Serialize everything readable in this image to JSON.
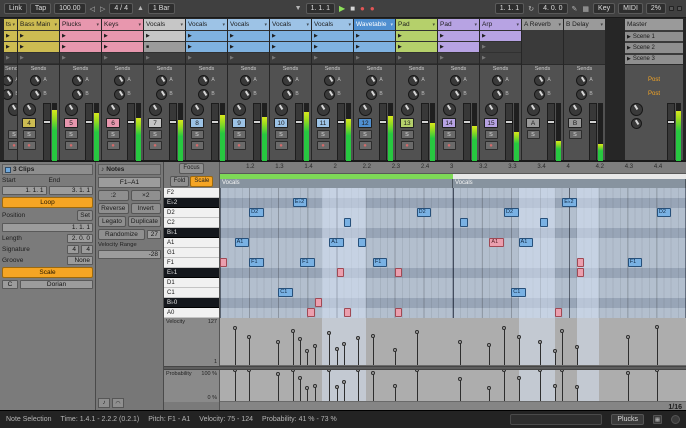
{
  "icons": {
    "follow": "▼",
    "play": "▶",
    "stop": "■",
    "record": "●",
    "session_record": "●",
    "metronome": "▲",
    "loop": "↻",
    "draw": "✎",
    "keyboard": "▦",
    "note": "♪",
    "envelope": "◠",
    "scene_play": "▶",
    "clip_play": "▶",
    "clip_stop": "■",
    "chevron": "▾",
    "lock": "◆"
  },
  "transport": {
    "link": "Link",
    "tap": "Tap",
    "tempo": "100.00",
    "nudge_down": "◁",
    "nudge_up": "▷",
    "sig": "4 / 4",
    "quantize": "1 Bar",
    "position": "1. 1. 1",
    "loop_start": "1. 1. 1",
    "loop_length": "4. 0. 0",
    "key": "Key",
    "midi": "MIDI",
    "cpu": "2%"
  },
  "session": {
    "sends_label": "Sends",
    "send_letters": [
      "A",
      "B"
    ],
    "solo_label": "S",
    "tracks": [
      {
        "name": "ts",
        "color": "#cdbc52",
        "partial": true,
        "num": "",
        "level": 0.8,
        "clips": [
          {
            "t": "clip",
            "c": "#cdbc52"
          },
          {
            "t": "clip",
            "c": "#cdbc52"
          },
          {
            "t": "empty"
          }
        ]
      },
      {
        "name": "Bass Main",
        "color": "#cdbc52",
        "num": "4",
        "level": 0.88,
        "clips": [
          {
            "t": "clip",
            "c": "#cdbc52"
          },
          {
            "t": "clip",
            "c": "#cdbc52"
          },
          {
            "t": "empty"
          }
        ]
      },
      {
        "name": "Plucks",
        "color": "#e897ae",
        "num": "5",
        "level": 0.82,
        "clips": [
          {
            "t": "clip",
            "c": "#e897ae"
          },
          {
            "t": "clip",
            "c": "#e897ae"
          },
          {
            "t": "empty"
          }
        ]
      },
      {
        "name": "Keys",
        "color": "#e897ae",
        "num": "6",
        "level": 0.75,
        "clips": [
          {
            "t": "clip",
            "c": "#e897ae"
          },
          {
            "t": "clip",
            "c": "#e897ae"
          },
          {
            "t": "empty"
          }
        ]
      },
      {
        "name": "Vocals",
        "color": "#c6c6c6",
        "num": "7",
        "level": 0.7,
        "clips": [
          {
            "t": "clip",
            "c": "#c6c6c6"
          },
          {
            "t": "stop"
          },
          {
            "t": "empty"
          }
        ]
      },
      {
        "name": "Vocals",
        "color": "#9dc3e6",
        "num": "8",
        "level": 0.8,
        "clips": [
          {
            "t": "clip",
            "c": "#7fb2e0"
          },
          {
            "t": "clip",
            "c": "#7fb2e0"
          },
          {
            "t": "empty"
          }
        ]
      },
      {
        "name": "Vocals",
        "color": "#9dc3e6",
        "num": "9",
        "level": 0.76,
        "clips": [
          {
            "t": "clip",
            "c": "#7fb2e0"
          },
          {
            "t": "clip",
            "c": "#7fb2e0"
          },
          {
            "t": "empty"
          }
        ]
      },
      {
        "name": "Vocals",
        "color": "#9dc3e6",
        "num": "10",
        "level": 0.84,
        "clips": [
          {
            "t": "clip",
            "c": "#7fb2e0"
          },
          {
            "t": "clip",
            "c": "#7fb2e0"
          },
          {
            "t": "empty"
          }
        ]
      },
      {
        "name": "Vocals",
        "color": "#9dc3e6",
        "num": "11",
        "level": 0.72,
        "clips": [
          {
            "t": "clip",
            "c": "#7fb2e0"
          },
          {
            "t": "clip",
            "c": "#7fb2e0"
          },
          {
            "t": "empty"
          }
        ]
      },
      {
        "name": "Wavetable",
        "color": "#4f8fd0",
        "selected": true,
        "num": "12",
        "level": 0.78,
        "clips": [
          {
            "t": "clip",
            "c": "#7fb2e0"
          },
          {
            "t": "clip",
            "c": "#7fb2e0"
          },
          {
            "t": "empty"
          }
        ]
      },
      {
        "name": "Pad",
        "color": "#b5d06b",
        "num": "13",
        "level": 0.66,
        "clips": [
          {
            "t": "clip",
            "c": "#b5d06b"
          },
          {
            "t": "clip",
            "c": "#b5d06b"
          },
          {
            "t": "empty"
          }
        ]
      },
      {
        "name": "Pad",
        "color": "#b7a3e3",
        "num": "14",
        "level": 0.6,
        "clips": [
          {
            "t": "clip",
            "c": "#b7a3e3"
          },
          {
            "t": "clip",
            "c": "#b7a3e3"
          },
          {
            "t": "empty"
          }
        ]
      },
      {
        "name": "Arp",
        "color": "#b7a3e3",
        "num": "15",
        "level": 0.5,
        "clips": [
          {
            "t": "clip",
            "c": "#b7a3e3"
          },
          {
            "t": "empty"
          },
          {
            "t": "empty"
          }
        ]
      },
      {
        "name": "A Reverb",
        "color": "#9a9a9a",
        "num": "A",
        "type": "return",
        "noarm": true,
        "level": 0.35,
        "clips": []
      },
      {
        "name": "B Delay",
        "color": "#9a9a9a",
        "num": "B",
        "type": "return",
        "noarm": true,
        "level": 0.3,
        "clips": []
      }
    ],
    "scenes": [
      "Scene 1",
      "Scene 2",
      "Scene 3"
    ],
    "master": {
      "name": "Master",
      "post_labels": [
        "Post",
        "Post"
      ],
      "level": 0.86
    }
  },
  "clip_panel": {
    "title": "3 Clips",
    "start_label": "Start",
    "end_label": "End",
    "start_value": "1. 1. 1",
    "end_value": "3. 1. 1",
    "loop_label": "Loop",
    "position_label": "Position",
    "set_label": "Set",
    "position_value": "1. 1. 1",
    "length_label": "Length",
    "length_value": "2. 0. 0",
    "signature_label": "Signature",
    "sig_num": "4",
    "sig_den": "4",
    "groove_label": "Groove",
    "groove_value": "None",
    "scale_label": "Scale",
    "root": "C",
    "scale_name": "Dorian"
  },
  "notes_panel": {
    "title": "Notes",
    "range": "F1–A1",
    "half": ":2",
    "double": "×2",
    "reverse": "Reverse",
    "invert": "Invert",
    "legato": "Legato",
    "duplicate": "Duplicate",
    "randomize_label": "Randomize",
    "randomize_value": "27",
    "velocity_range_label": "Velocity Range",
    "velocity_range_value": "-28"
  },
  "editor": {
    "focus": "Focus",
    "fold": "Fold",
    "scale": "Scale",
    "grid_label": "1/16",
    "ruler": [
      "1.2",
      "1.3",
      "1.4",
      "2",
      "2.2",
      "2.3",
      "2.4",
      "3",
      "3.2",
      "3.3",
      "3.4",
      "4",
      "4.2",
      "4.3",
      "4.4"
    ],
    "clip_regions": [
      {
        "label": "Vocals",
        "s": 0,
        "d": 32,
        "bar": "#7ed957"
      },
      {
        "label": "Vocals",
        "s": 32,
        "d": 32,
        "bar": "#e8e8e8"
      }
    ],
    "pitches": [
      {
        "name": "F2",
        "black": false
      },
      {
        "name": "E♭2",
        "black": true
      },
      {
        "name": "D2",
        "black": false
      },
      {
        "name": "C2",
        "black": false
      },
      {
        "name": "B♭1",
        "black": true
      },
      {
        "name": "A1",
        "black": false
      },
      {
        "name": "G1",
        "black": false
      },
      {
        "name": "F1",
        "black": false
      },
      {
        "name": "E♭1",
        "black": true
      },
      {
        "name": "D1",
        "black": false
      },
      {
        "name": "C1",
        "black": false
      },
      {
        "name": "B♭0",
        "black": true
      },
      {
        "name": "A0",
        "black": false
      }
    ],
    "selection_bands": [
      {
        "s": 14,
        "d": 6
      },
      {
        "s": 41,
        "d": 5
      },
      {
        "s": 49,
        "d": 3
      }
    ],
    "notes": [
      {
        "row": 5,
        "s": 2,
        "d": 2,
        "label": "A1"
      },
      {
        "row": 2,
        "s": 4,
        "d": 2,
        "label": "D2"
      },
      {
        "row": 7,
        "s": 0,
        "d": 1,
        "muted": true
      },
      {
        "row": 7,
        "s": 4,
        "d": 2,
        "label": "F1"
      },
      {
        "row": 10,
        "s": 8,
        "d": 2,
        "label": "C1"
      },
      {
        "row": 1,
        "s": 10,
        "d": 2,
        "label": "E♭2"
      },
      {
        "row": 7,
        "s": 11,
        "d": 2,
        "label": "F1"
      },
      {
        "row": 12,
        "s": 12,
        "d": 1,
        "muted": true
      },
      {
        "row": 11,
        "s": 13,
        "d": 1,
        "muted": true
      },
      {
        "row": 5,
        "s": 15,
        "d": 2,
        "label": "A1"
      },
      {
        "row": 8,
        "s": 16,
        "d": 1,
        "muted": true
      },
      {
        "row": 3,
        "s": 17,
        "d": 1
      },
      {
        "row": 12,
        "s": 17,
        "d": 1,
        "muted": true
      },
      {
        "row": 5,
        "s": 19,
        "d": 1
      },
      {
        "row": 7,
        "s": 21,
        "d": 2,
        "label": "F1"
      },
      {
        "row": 8,
        "s": 24,
        "d": 1,
        "muted": true
      },
      {
        "row": 12,
        "s": 24,
        "d": 1,
        "muted": true
      },
      {
        "row": 2,
        "s": 27,
        "d": 2,
        "label": "D2"
      },
      {
        "row": 3,
        "s": 33,
        "d": 1
      },
      {
        "row": 5,
        "s": 37,
        "d": 2,
        "label": "A1",
        "muted": true
      },
      {
        "row": 2,
        "s": 39,
        "d": 2,
        "label": "D2"
      },
      {
        "row": 10,
        "s": 40,
        "d": 2,
        "label": "C1"
      },
      {
        "row": 5,
        "s": 41,
        "d": 2,
        "label": "A1"
      },
      {
        "row": 3,
        "s": 44,
        "d": 1
      },
      {
        "row": 12,
        "s": 46,
        "d": 1,
        "muted": true
      },
      {
        "row": 1,
        "s": 47,
        "d": 2,
        "label": "E♭2"
      },
      {
        "row": 7,
        "s": 49,
        "d": 1,
        "muted": true
      },
      {
        "row": 8,
        "s": 49,
        "d": 1,
        "muted": true
      },
      {
        "row": 7,
        "s": 56,
        "d": 2,
        "label": "F1"
      },
      {
        "row": 2,
        "s": 60,
        "d": 2,
        "label": "D2"
      }
    ],
    "velocity": {
      "label": "Velocity",
      "top": "127",
      "bottom": "1",
      "markers": [
        {
          "u": 2,
          "v": 0.78
        },
        {
          "u": 4,
          "v": 0.6
        },
        {
          "u": 8,
          "v": 0.5
        },
        {
          "u": 10,
          "v": 0.72
        },
        {
          "u": 11,
          "v": 0.55
        },
        {
          "u": 12,
          "v": 0.3
        },
        {
          "u": 13,
          "v": 0.4
        },
        {
          "u": 15,
          "v": 0.68
        },
        {
          "u": 16,
          "v": 0.35
        },
        {
          "u": 17,
          "v": 0.45
        },
        {
          "u": 19,
          "v": 0.58
        },
        {
          "u": 21,
          "v": 0.62
        },
        {
          "u": 24,
          "v": 0.33
        },
        {
          "u": 27,
          "v": 0.7
        },
        {
          "u": 33,
          "v": 0.5
        },
        {
          "u": 37,
          "v": 0.42
        },
        {
          "u": 39,
          "v": 0.78
        },
        {
          "u": 41,
          "v": 0.6
        },
        {
          "u": 44,
          "v": 0.5
        },
        {
          "u": 46,
          "v": 0.3
        },
        {
          "u": 47,
          "v": 0.72
        },
        {
          "u": 49,
          "v": 0.38
        },
        {
          "u": 56,
          "v": 0.6
        },
        {
          "u": 60,
          "v": 0.8
        }
      ]
    },
    "probability": {
      "label": "Probability",
      "top": "100 %",
      "bottom": "0 %",
      "markers": [
        {
          "u": 2,
          "v": 1
        },
        {
          "u": 4,
          "v": 1
        },
        {
          "u": 8,
          "v": 0.88
        },
        {
          "u": 10,
          "v": 1
        },
        {
          "u": 11,
          "v": 0.73
        },
        {
          "u": 12,
          "v": 0.41
        },
        {
          "u": 13,
          "v": 0.5
        },
        {
          "u": 15,
          "v": 1
        },
        {
          "u": 16,
          "v": 0.45
        },
        {
          "u": 17,
          "v": 0.6
        },
        {
          "u": 19,
          "v": 1
        },
        {
          "u": 21,
          "v": 0.9
        },
        {
          "u": 24,
          "v": 0.5
        },
        {
          "u": 27,
          "v": 1
        },
        {
          "u": 33,
          "v": 0.7
        },
        {
          "u": 37,
          "v": 0.41
        },
        {
          "u": 39,
          "v": 1
        },
        {
          "u": 41,
          "v": 0.73
        },
        {
          "u": 44,
          "v": 1
        },
        {
          "u": 46,
          "v": 0.5
        },
        {
          "u": 47,
          "v": 1
        },
        {
          "u": 49,
          "v": 0.45
        },
        {
          "u": 56,
          "v": 0.9
        },
        {
          "u": 60,
          "v": 1
        }
      ]
    }
  },
  "status_bar": {
    "mode": "Note Selection",
    "time": "Time: 1.4.1 - 2.2.2 (0.2.1)",
    "pitch": "Pitch: F1 - A1",
    "velocity": "Velocity: 75 - 124",
    "probability": "Probability: 41 % - 73 %",
    "track": "Plucks"
  }
}
